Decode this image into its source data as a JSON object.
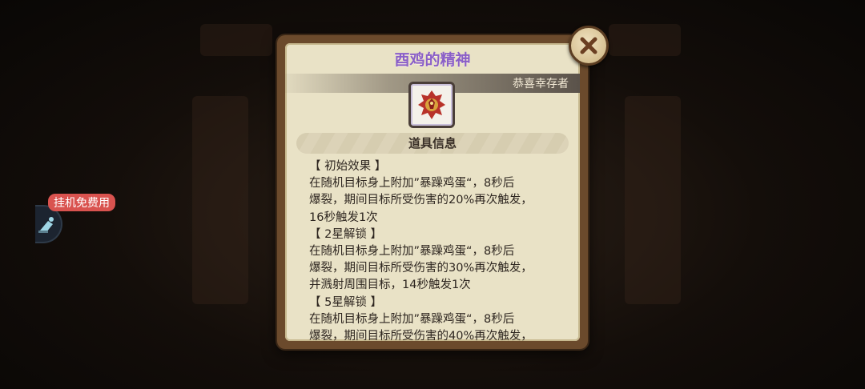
{
  "idle_button": {
    "label": "挂机免费用",
    "icon": "idle-character-icon"
  },
  "dialog": {
    "title": "酉鸡的精神",
    "banner_text": "恭喜幸存者",
    "item_icon": "rooster-emblem-icon",
    "section_title": "道具信息",
    "description_lines": [
      "【 初始效果 】",
      "在随机目标身上附加”暴躁鸡蛋“，8秒后",
      "爆裂，期间目标所受伤害的20%再次触发，",
      "16秒触发1次",
      "【 2星解锁 】",
      "在随机目标身上附加”暴躁鸡蛋“，8秒后",
      "爆裂，期间目标所受伤害的30%再次触发，",
      "并溅射周围目标，14秒触发1次",
      "【 5星解锁 】",
      "在随机目标身上附加”暴躁鸡蛋“，8秒后",
      "爆裂，期间目标所受伤害的40%再次触发，"
    ],
    "close_icon": "close-icon"
  },
  "colors": {
    "title": "#8a5fc8",
    "panel": "#e9e2c6",
    "frame": "#6b4a2c",
    "badge": "#d9534f"
  }
}
